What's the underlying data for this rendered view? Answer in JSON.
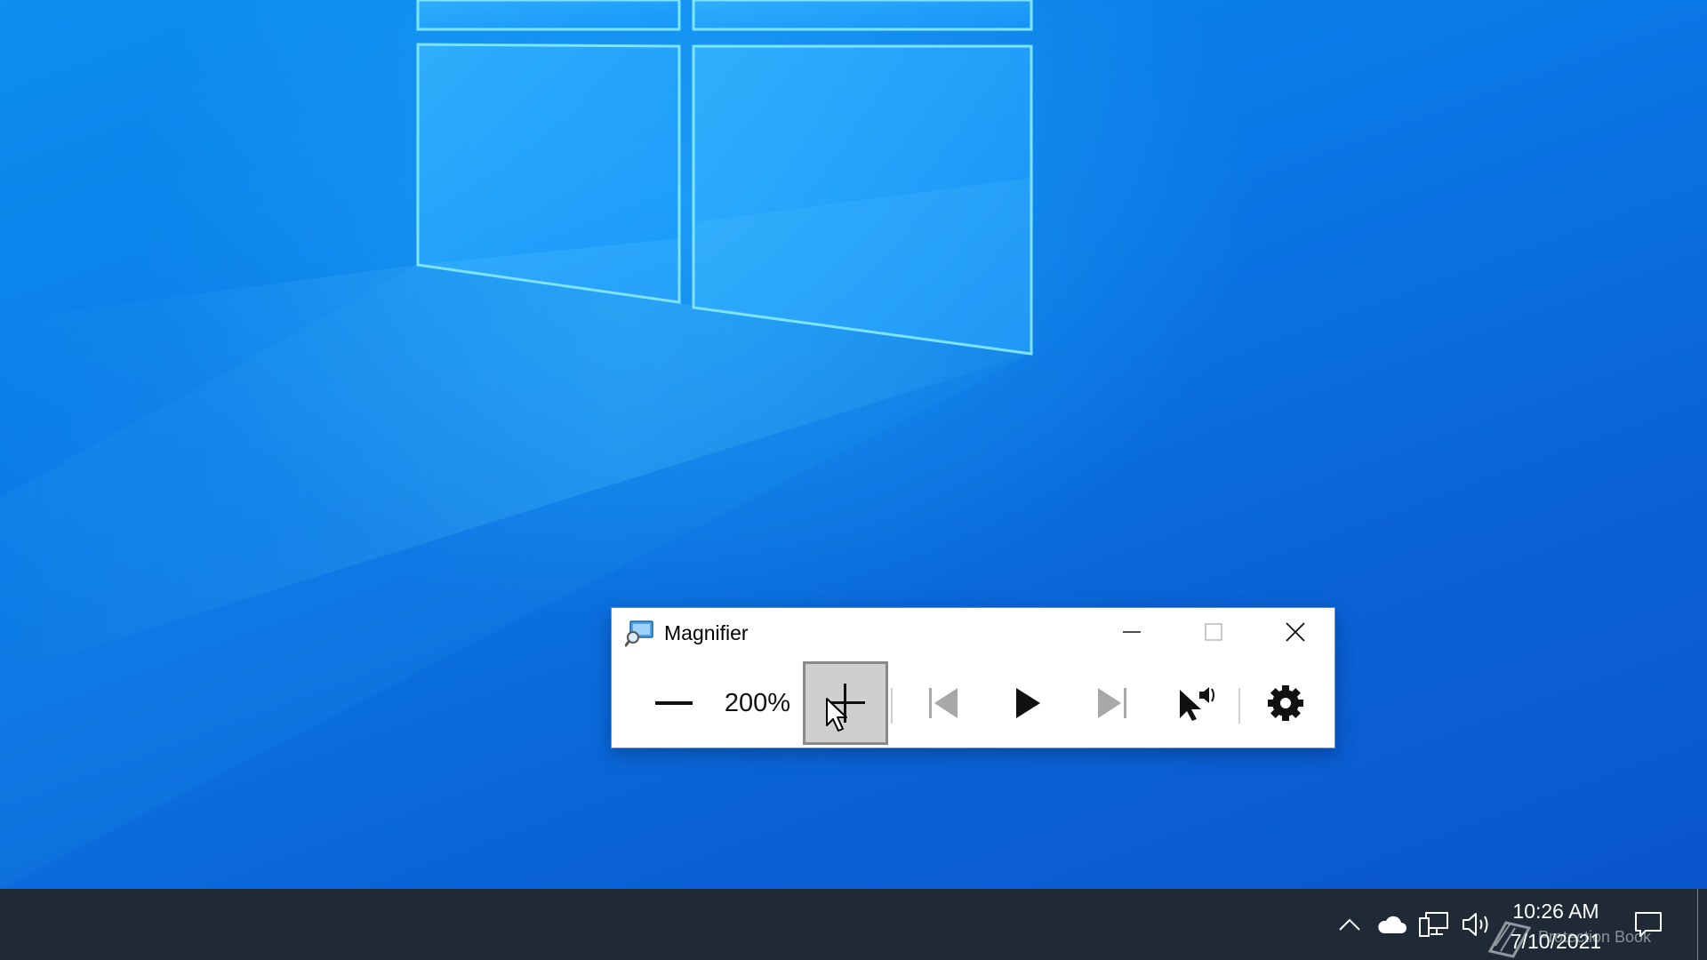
{
  "window": {
    "title": "Magnifier",
    "minimize_icon": "minimize-icon",
    "maximize_icon": "maximize-icon",
    "close_icon": "close-icon"
  },
  "toolbar": {
    "zoom_out_icon": "minus-icon",
    "zoom_level": "200%",
    "zoom_in_icon": "plus-icon",
    "previous_icon": "skip-back-icon",
    "play_icon": "play-icon",
    "next_icon": "skip-forward-icon",
    "read_from_here_icon": "pointer-speaker-icon",
    "settings_icon": "gear-icon"
  },
  "taskbar": {
    "time": "10:26 AM",
    "date": "7/10/2021",
    "tray_icons": [
      "chevron-up-icon",
      "onedrive-cloud-icon",
      "network-icon",
      "volume-icon",
      "notifications-icon"
    ]
  },
  "watermark": {
    "text": "Protection Book"
  },
  "colors": {
    "desktop_blue": "#0a78e6",
    "taskbar": "#1f2a36",
    "pressed_button": "#cfcfcf"
  }
}
